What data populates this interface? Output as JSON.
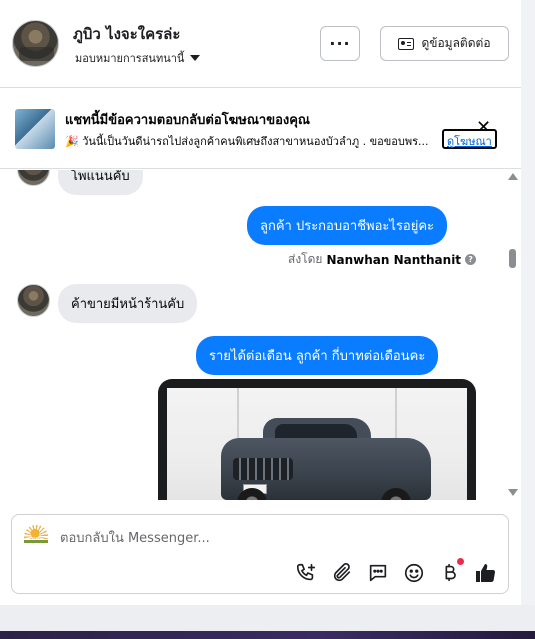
{
  "header": {
    "page_name": "ภูบิว ไงจะใครล่ะ",
    "assign_label": "มอบหมายการสนทนานี้",
    "more_label": "···",
    "contact_label": "ดูข้อมูลติดต่อ"
  },
  "ad_banner": {
    "title": "แชทนี้มีข้อความตอบกลับต่อโฆษณาของคุณ",
    "text": "🎉 วันนี้เป็นวันดีน่ารถไปส่งลูกค้าคนพิเศษถึงสาขาหนองบัวลำภู . ขอขอบพร...",
    "view_ad_label": "ดูโฆษณา",
    "close_label": "✕"
  },
  "messages": [
    {
      "direction": "in",
      "text": "โพแนนคับ"
    },
    {
      "direction": "out",
      "text": "ลูกค้า  ประกอบอาชีพอะไรอยู่คะ"
    },
    {
      "direction": "in",
      "text": "ค้าขายมีหน้าร้านคับ"
    },
    {
      "direction": "out",
      "text": "รายได้ต่อเดือน ลูกค้า  กี่บาทต่อเดือนคะ"
    }
  ],
  "sent_by": {
    "prefix": "ส่งโดย",
    "name": "Nanwhan Nanthanit"
  },
  "composer": {
    "placeholder": "ตอบกลับใน Messenger..."
  },
  "colors": {
    "outgoing_bubble": "#0a7cff",
    "incoming_bubble": "#e9eaed",
    "like": "#1c1e21",
    "notification_dot": "#f02849"
  }
}
